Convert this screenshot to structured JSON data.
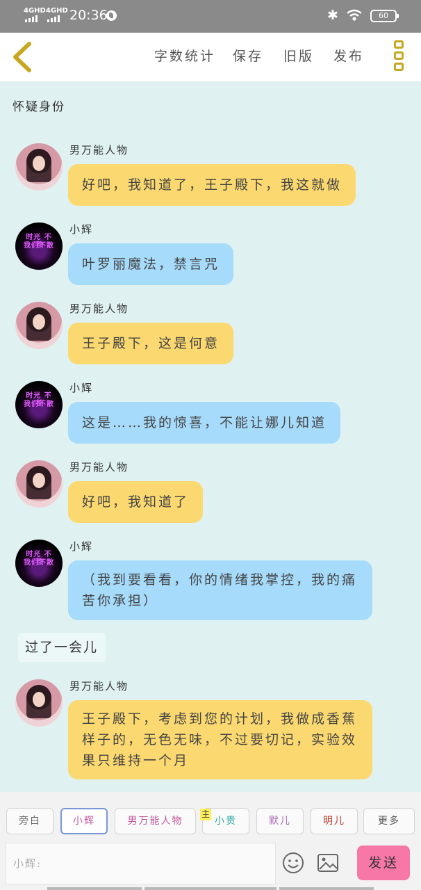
{
  "status_bar": {
    "net1": "4GHD",
    "net2": "4GHD",
    "time": "20:36",
    "battery": "60"
  },
  "nav": {
    "links": [
      "字数统计",
      "保存",
      "旧版",
      "发布"
    ]
  },
  "section_title": "怀疑身份",
  "messages": [
    {
      "sender": "男万能人物",
      "avatar": "male",
      "color": "yellow",
      "lines": [
        "好吧，我知道了，王子殿下，我这就做"
      ]
    },
    {
      "sender": "小辉",
      "avatar": "hui",
      "color": "blue",
      "lines": [
        "叶罗丽魔法，禁言咒"
      ]
    },
    {
      "sender": "男万能人物",
      "avatar": "male",
      "color": "yellow",
      "lines": [
        "王子殿下，这是何意"
      ]
    },
    {
      "sender": "小辉",
      "avatar": "hui",
      "color": "blue",
      "lines": [
        "这是……我的惊喜，不能让娜儿知道"
      ]
    },
    {
      "sender": "男万能人物",
      "avatar": "male",
      "color": "yellow",
      "lines": [
        "好吧，我知道了"
      ]
    },
    {
      "sender": "小辉",
      "avatar": "hui",
      "color": "blue",
      "lines": [
        "（我到要看看，你的情绪我掌控，我的痛",
        "苦你承担）"
      ]
    },
    {
      "sender": "男万能人物",
      "avatar": "male",
      "color": "yellow",
      "lines": [
        "王子殿下，考虑到您的计划，我做成香蕉",
        "样子的，无色无味，不过要切记，实验效",
        "果只维持一个月"
      ]
    }
  ],
  "avatar_text": {
    "line1": "时光 不老",
    "line2": "我们不散"
  },
  "narration": "过了一会儿",
  "role_chips": [
    {
      "label": "旁白",
      "color": "#666666"
    },
    {
      "label": "小辉",
      "color": "#c2559a",
      "selected": true
    },
    {
      "label": "男万能人物",
      "color": "#c2559a"
    },
    {
      "label": "小贵",
      "color": "#2aa6a0"
    },
    {
      "label": "默儿",
      "color": "#a86ab8"
    },
    {
      "label": "明儿",
      "color": "#c0392b"
    },
    {
      "label": "更多",
      "color": "#555555"
    }
  ],
  "main_badge": "主",
  "input": {
    "placeholder": "小辉:"
  },
  "send_label": "发送"
}
